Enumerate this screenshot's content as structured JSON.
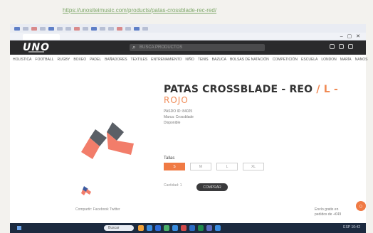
{
  "caption": {
    "url": "https://unositeimusic.com/products/patas-crossblade-rec-red/"
  },
  "browser": {
    "tab_title": "",
    "window_icons": "– ▢ ✕"
  },
  "header": {
    "logo": "UNO",
    "search_placeholder": "BUSCA PRODUCTOS",
    "icons": [
      "user-icon",
      "cart-icon",
      "menu-icon"
    ]
  },
  "nav": {
    "items": [
      "HOLISTICA",
      "FOOTBALL",
      "RUGBY",
      "BOXEO",
      "PADEL",
      "BAÑADORES",
      "TEXTILES",
      "ENTRENAMIENTO",
      "NIÑO",
      "TENIS",
      "BAZUCA",
      "BOLSAS DE NATACIÓN",
      "COMPETICIÓN",
      "ESCUELA",
      "LONDON",
      "MARÍA",
      "NANOS"
    ]
  },
  "product": {
    "title": "PATAS CROSSBLADE - REO",
    "title_suffix": "/ L -",
    "color_name": "ROJO",
    "ref": "PASDO ID: 84025",
    "brand": "Marca: Crossblade",
    "availability": "Disponible",
    "price_note": "",
    "size_label": "Tallas",
    "sizes": [
      "S",
      "M",
      "L",
      "XL"
    ],
    "selected_size_index": 0,
    "qty_label": "Cantidad: 1",
    "buy_label": "COMPRAR",
    "share_text": "Compartir: Facebook Twitter",
    "side_note": "Envío gratis en pedidos de +€49"
  },
  "chat": {
    "icon": "chat-icon",
    "glyph": "○"
  },
  "taskbar": {
    "search_placeholder": "Buscar",
    "tray": "ESP 10:42"
  },
  "colors": {
    "accent": "#f07a44",
    "header_bg": "#2a2a2c",
    "taskbar_bg": "#1c2a3f"
  }
}
